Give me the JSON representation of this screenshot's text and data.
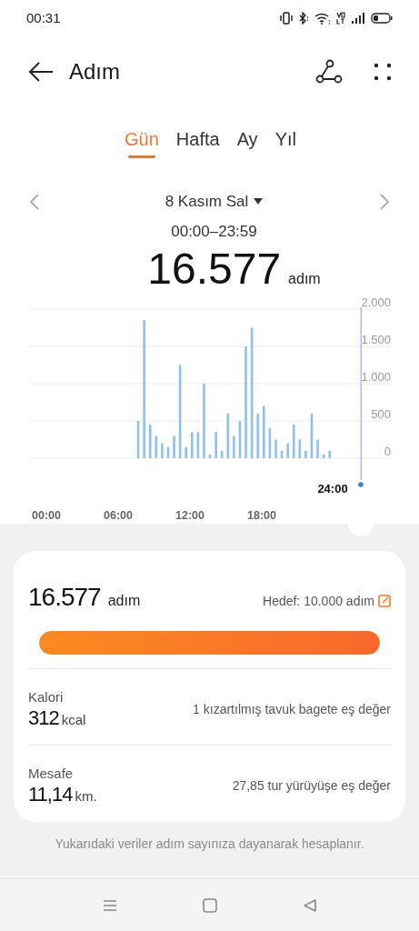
{
  "status_bar": {
    "time": "00:31"
  },
  "header": {
    "title": "Adım"
  },
  "tabs": [
    {
      "label": "Gün",
      "selected": true
    },
    {
      "label": "Hafta",
      "selected": false
    },
    {
      "label": "Ay",
      "selected": false
    },
    {
      "label": "Yıl",
      "selected": false
    }
  ],
  "date_nav": {
    "date": "8 Kasım Sal",
    "time_range": "00:00–23:59"
  },
  "total": {
    "value": "16.577",
    "unit": "adım"
  },
  "chart": {
    "chart_data": {
      "type": "bar",
      "x": [
        7.5,
        8,
        8.5,
        9,
        9.5,
        10,
        10.5,
        11,
        11.5,
        12,
        12.5,
        13,
        13.5,
        14,
        14.5,
        15,
        15.5,
        16,
        16.5,
        17,
        17.5,
        18,
        18.5,
        19,
        19.5,
        20,
        20.5,
        21,
        21.5,
        22,
        22.5,
        23,
        23.5
      ],
      "values": [
        500,
        1850,
        450,
        300,
        200,
        150,
        300,
        1250,
        150,
        350,
        350,
        1000,
        50,
        350,
        100,
        600,
        300,
        500,
        1500,
        1750,
        600,
        700,
        400,
        250,
        100,
        200,
        450,
        250,
        100,
        600,
        250,
        50,
        100
      ],
      "grid": true,
      "xlim": [
        0,
        24
      ],
      "ylim": [
        0,
        2000
      ],
      "xticks": [
        {
          "value": 0,
          "label": "00:00"
        },
        {
          "value": 6,
          "label": "06:00"
        },
        {
          "value": 12,
          "label": "12:00"
        },
        {
          "value": 18,
          "label": "18:00"
        }
      ],
      "yticks": [
        {
          "value": 0,
          "label": "0"
        },
        {
          "value": 500,
          "label": "500"
        },
        {
          "value": 1000,
          "label": "1.000"
        },
        {
          "value": 1500,
          "label": "1.500"
        },
        {
          "value": 2000,
          "label": "2.000"
        }
      ],
      "annotations": [
        "24:00"
      ]
    }
  },
  "summary": {
    "value": "16.577",
    "unit": "adım",
    "goal": "Hedef: 10.000 adım",
    "level": 1
  },
  "metrics": [
    {
      "label": "Kalori",
      "value": "312",
      "unit": "kcal",
      "equivalent": "1 kızartılmış tavuk bagete eş değer"
    },
    {
      "label": "Mesafe",
      "value": "11,14",
      "unit": "km.",
      "equivalent": "27,85 tur yürüyüşe eş değer"
    }
  ],
  "footnote": "Yukarıdaki veriler adım sayınıza dayanarak hesaplanır."
}
